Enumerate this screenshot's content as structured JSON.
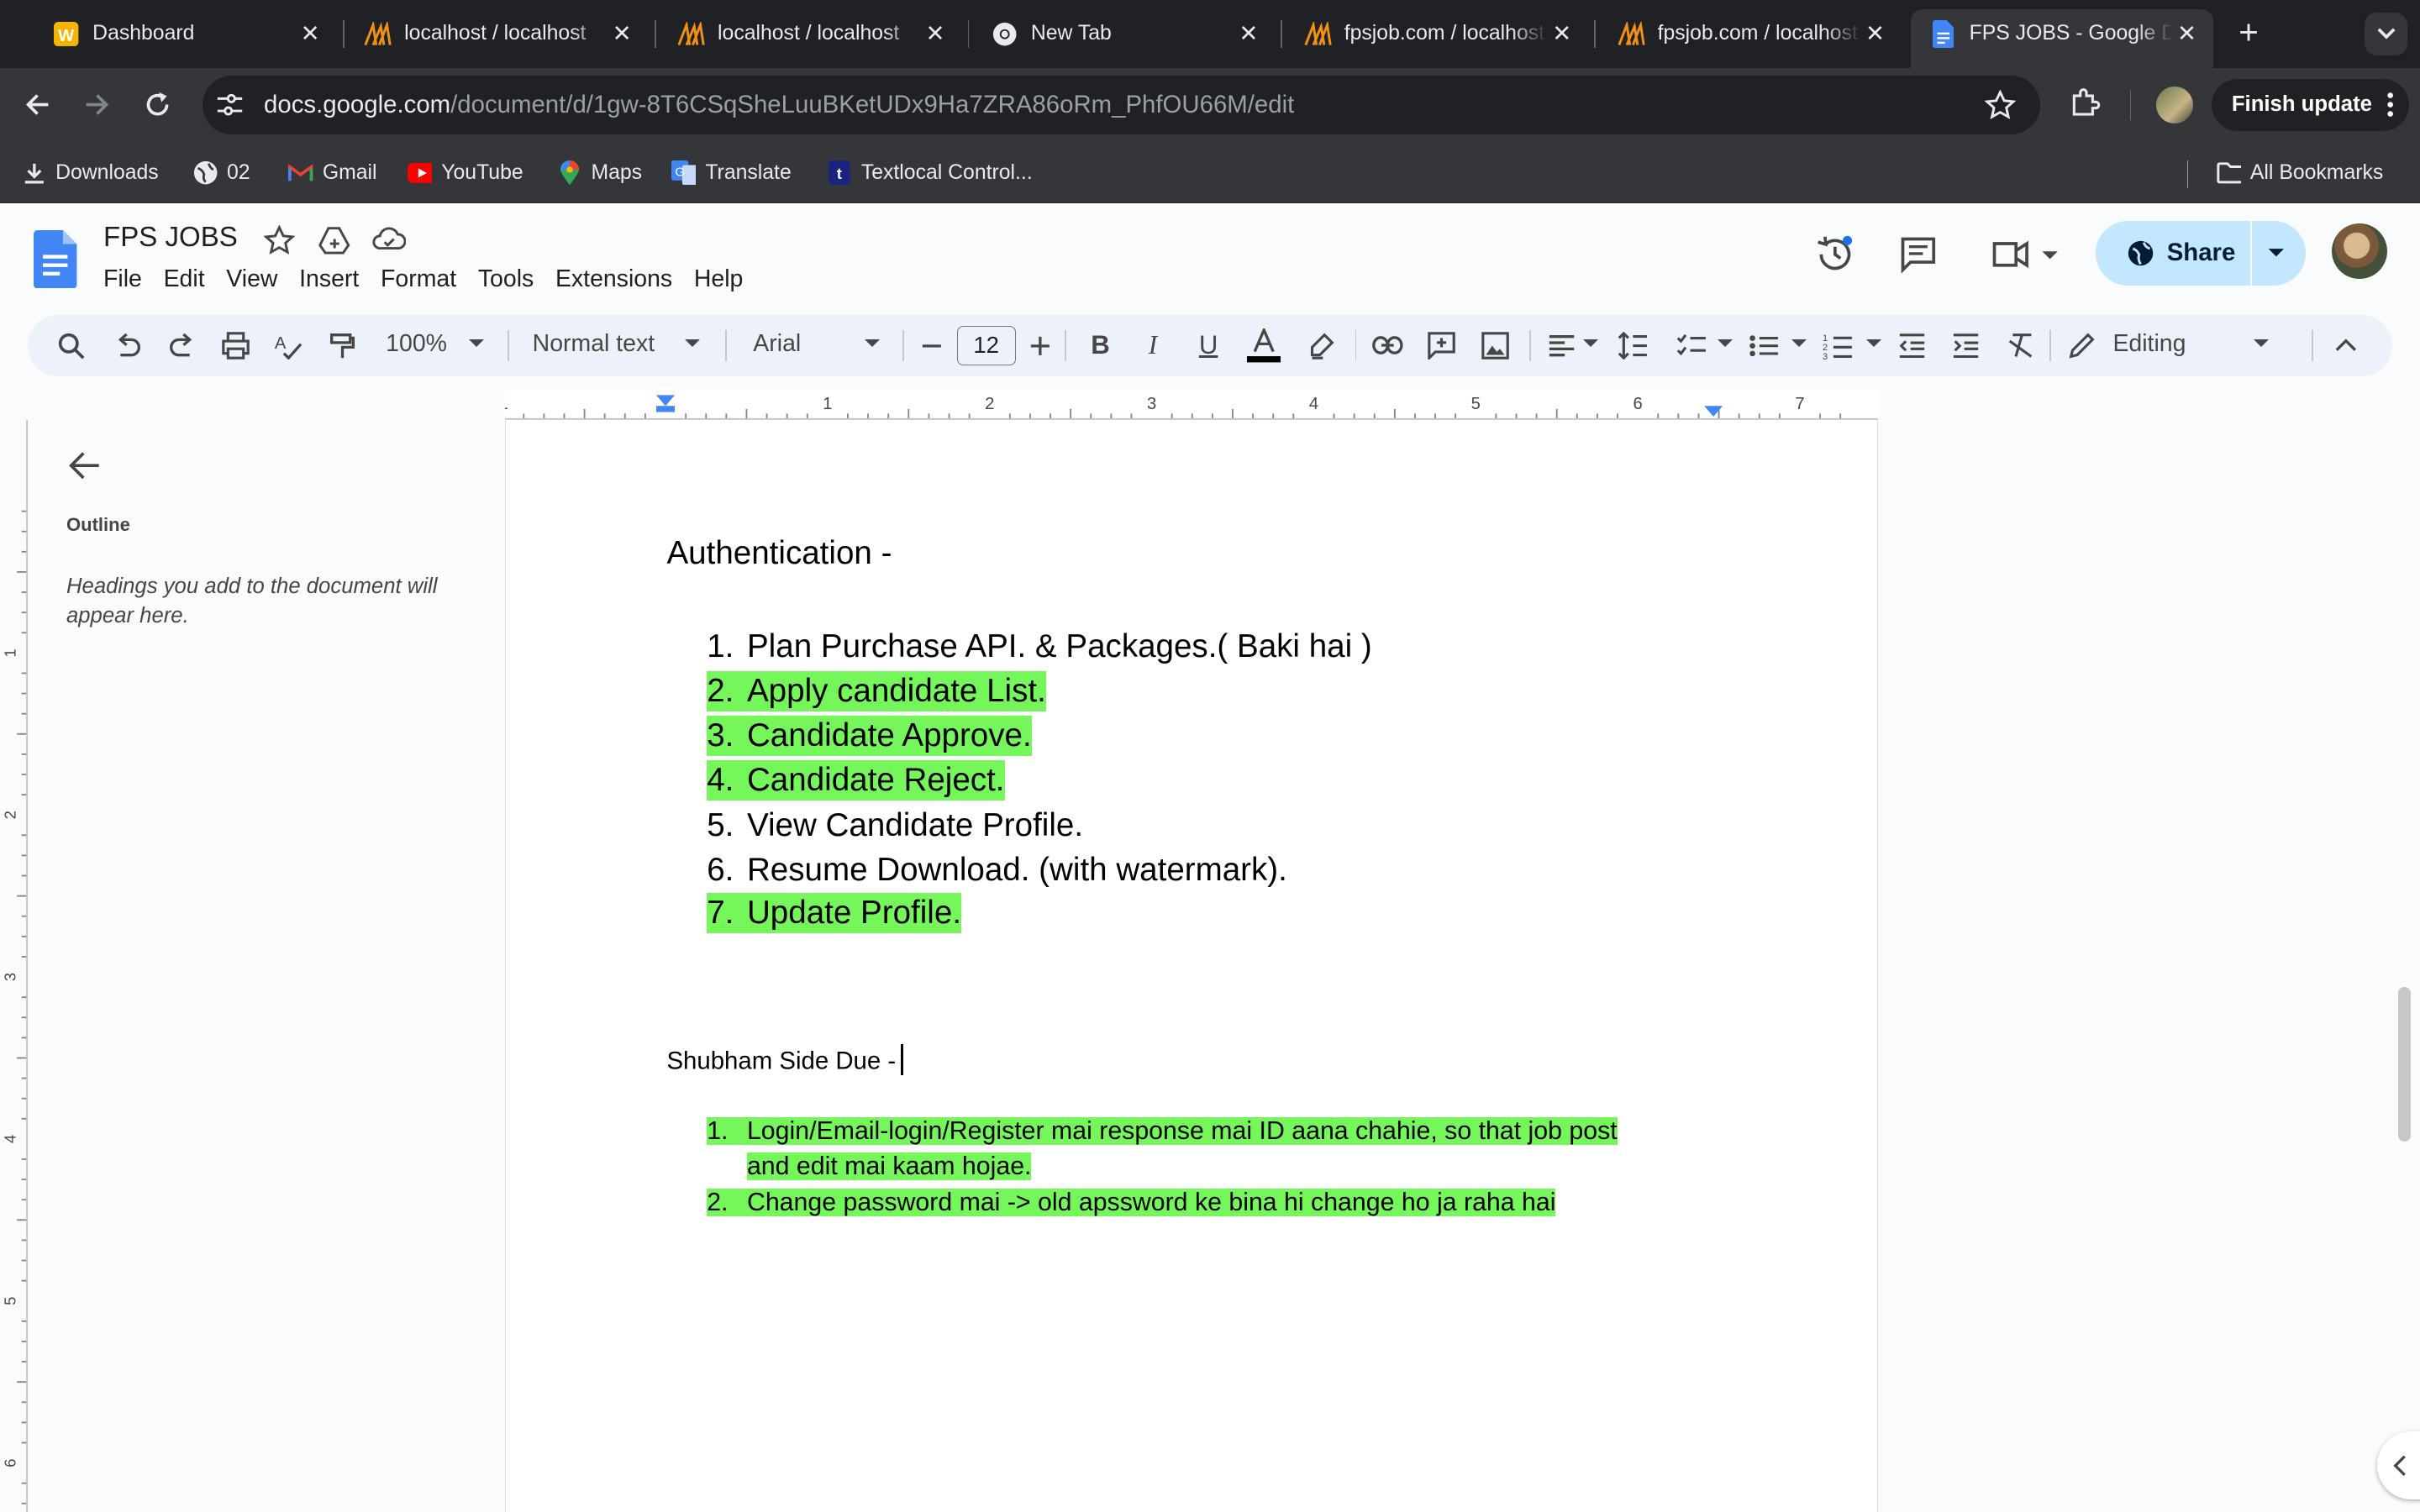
{
  "browser": {
    "tabs": [
      {
        "title": "Dashboard",
        "icon": "w-logo-icon",
        "color": "#f4b400"
      },
      {
        "title": "localhost / localhost",
        "icon": "phpmyadmin-icon"
      },
      {
        "title": "localhost / localhost",
        "icon": "phpmyadmin-icon"
      },
      {
        "title": "New Tab",
        "icon": "chrome-icon"
      },
      {
        "title": "fpsjob.com / localhost",
        "icon": "phpmyadmin-icon"
      },
      {
        "title": "fpsjob.com / localhost",
        "icon": "phpmyadmin-icon"
      },
      {
        "title": "FPS JOBS - Google Docs",
        "icon": "docs-icon",
        "active": true
      }
    ],
    "url_host": "docs.google.com",
    "url_path": "/document/d/1gw-8T6CSqSheLuuBKetUDx9Ha7ZRA86oRm_PhfOU66M/edit",
    "finish_update_label": "Finish update",
    "bookmarks": [
      {
        "label": "Downloads",
        "icon": "download-icon"
      },
      {
        "label": "02",
        "icon": "globe-icon"
      },
      {
        "label": "Gmail",
        "icon": "gmail-icon"
      },
      {
        "label": "YouTube",
        "icon": "youtube-icon"
      },
      {
        "label": "Maps",
        "icon": "maps-icon"
      },
      {
        "label": "Translate",
        "icon": "translate-icon"
      },
      {
        "label": "Textlocal Control...",
        "icon": "textlocal-icon"
      }
    ],
    "all_bookmarks_label": "All Bookmarks"
  },
  "docs": {
    "title": "FPS JOBS",
    "menu": [
      "File",
      "Edit",
      "View",
      "Insert",
      "Format",
      "Tools",
      "Extensions",
      "Help"
    ],
    "share_label": "Share",
    "toolbar": {
      "zoom": "100%",
      "style": "Normal text",
      "font": "Arial",
      "font_size": "12",
      "mode": "Editing"
    },
    "ruler_numbers": [
      "1",
      "1",
      "2",
      "3",
      "4",
      "5",
      "6",
      "7"
    ],
    "vruler_numbers": [
      "1",
      "2",
      "3",
      "4",
      "5",
      "6"
    ],
    "outline": {
      "title": "Outline",
      "hint": "Headings you add to the document will appear here."
    },
    "content": {
      "heading1": "Authentication -",
      "list1": [
        {
          "num": "1.",
          "text": "Plan Purchase API. & Packages.( Baki hai )",
          "highlight": false
        },
        {
          "num": "2.",
          "text": "Apply candidate List.",
          "highlight": true
        },
        {
          "num": "3.",
          "text": "Candidate Approve.",
          "highlight": true
        },
        {
          "num": "4.",
          "text": "Candidate Reject.",
          "highlight": true
        },
        {
          "num": "5.",
          "text": "View Candidate Profile.",
          "highlight": false
        },
        {
          "num": "6.",
          "text": "Resume Download. (with watermark).",
          "highlight": false
        },
        {
          "num": "7.",
          "text": "Update Profile.",
          "highlight": true
        }
      ],
      "heading2": "Shubham Side Due -",
      "list2": [
        {
          "num": "1.",
          "line1": "Login/Email-login/Register mai response mai ID aana chahie, so that job post",
          "line2": "and edit mai kaam hojae."
        },
        {
          "num": "2.",
          "line1": "Change password mai -> old apssword ke bina hi change ho ja raha hai"
        }
      ]
    },
    "highlight_color": "#75f65b"
  }
}
